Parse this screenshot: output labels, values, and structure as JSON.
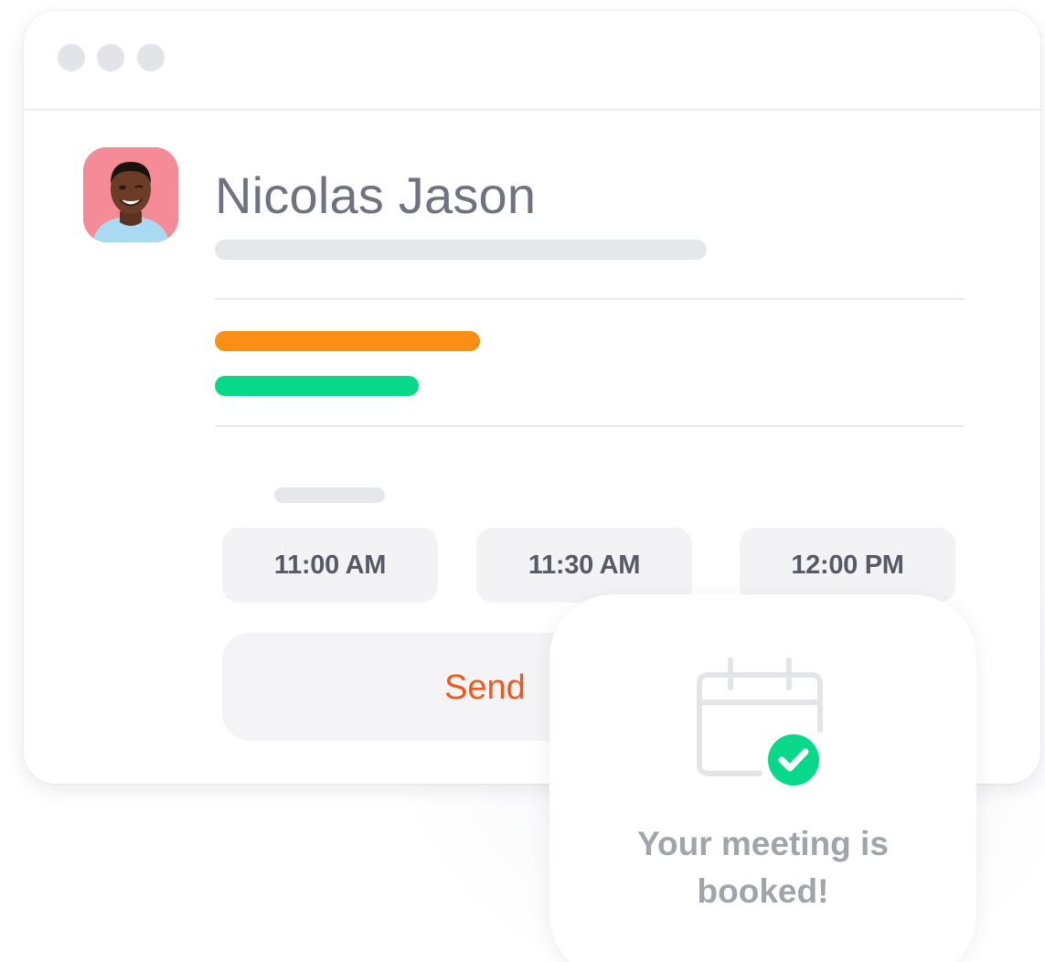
{
  "window": {
    "controls": [
      "window-dot",
      "window-dot",
      "window-dot"
    ]
  },
  "profile": {
    "name": "Nicolas Jason",
    "avatar_icon": "person-photo"
  },
  "colors": {
    "accent_orange": "#fb8e14",
    "accent_green": "#07d88a",
    "send_text": "#f2581e",
    "check_green": "#07d88a"
  },
  "time_slots": [
    {
      "label": "11:00 AM"
    },
    {
      "label": "11:30 AM"
    },
    {
      "label": "12:00 PM"
    }
  ],
  "send_button": {
    "label": "Send"
  },
  "confirmation": {
    "icon": "calendar-check-icon",
    "line1": "Your meeting is",
    "line2": "booked!"
  }
}
